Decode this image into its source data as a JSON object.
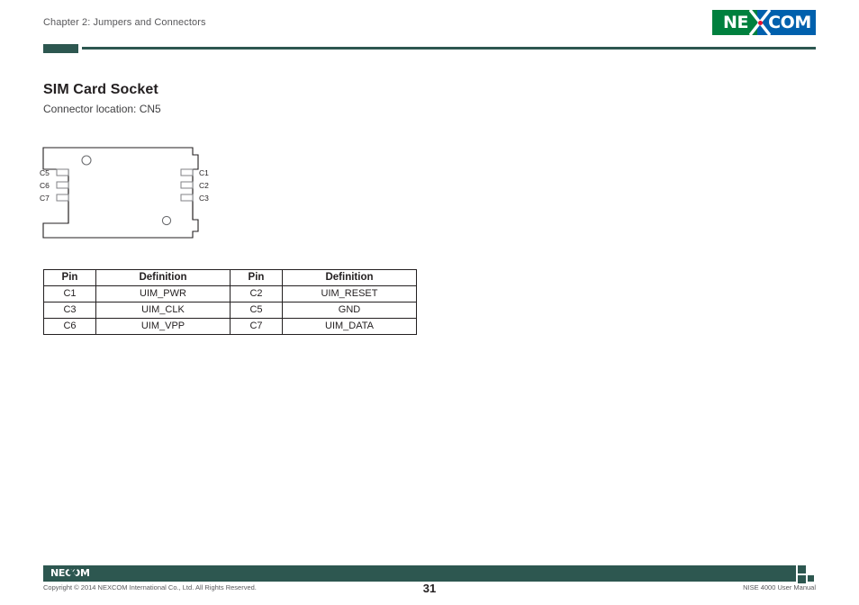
{
  "header": {
    "chapter": "Chapter 2: Jumpers and Connectors",
    "logo": {
      "left_text": "NE",
      "right_text": "COM",
      "green": "#00803e",
      "blue": "#0060ad",
      "dot_color": "#e8112d"
    },
    "accent_color": "#2d5750"
  },
  "content": {
    "title": "SIM Card Socket",
    "connector_location": "Connector location: CN5"
  },
  "diagram": {
    "name": "sim-card-socket-diagram",
    "left_pins": [
      "C5",
      "C6",
      "C7"
    ],
    "right_pins": [
      "C1",
      "C2",
      "C3"
    ],
    "hole_count": 2
  },
  "table": {
    "headers": [
      "Pin",
      "Definition",
      "Pin",
      "Definition"
    ],
    "rows": [
      [
        "C1",
        "UIM_PWR",
        "C2",
        "UIM_RESET"
      ],
      [
        "C3",
        "UIM_CLK",
        "C5",
        "GND"
      ],
      [
        "C6",
        "UIM_VPP",
        "C7",
        "UIM_DATA"
      ]
    ]
  },
  "footer": {
    "logo_left": "NE",
    "logo_right": "COM",
    "copyright": "Copyright © 2014 NEXCOM International Co., Ltd. All Rights Reserved.",
    "page_number": "31",
    "manual_name": "NISE 4000 User Manual"
  }
}
